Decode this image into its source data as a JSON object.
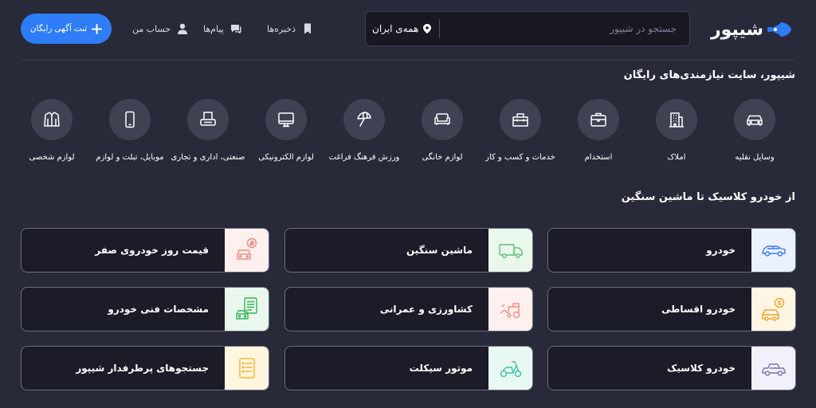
{
  "header": {
    "logo_text": "شیپور",
    "search": {
      "placeholder": "جستجو در شیپور",
      "value": ""
    },
    "city": "همه‌ی ایران",
    "nav": {
      "saved": "ذخیره‌ها",
      "messages": "پیام‌ها",
      "account": "حساب من"
    },
    "post_button": "ثبت آگهی رایگان"
  },
  "categories_title": "شیپور، سایت نیازمندی‌های رایگان",
  "categories": [
    {
      "label": "وسایل نقلیه",
      "icon": "car-icon"
    },
    {
      "label": "املاک",
      "icon": "building-icon"
    },
    {
      "label": "استخدام",
      "icon": "briefcase-icon"
    },
    {
      "label": "خدمات و کسب و کار",
      "icon": "toolbox-icon"
    },
    {
      "label": "لوازم خانگی",
      "icon": "sofa-icon"
    },
    {
      "label": "ورزش فرهنگ فراغت",
      "icon": "umbrella-icon"
    },
    {
      "label": "لوازم الکترونیکی",
      "icon": "monitor-icon"
    },
    {
      "label": "صنعتی، اداری و تجاری",
      "icon": "printer-icon"
    },
    {
      "label": "موبایل، تبلت و لوازم",
      "icon": "mobile-icon"
    },
    {
      "label": "لوازم شخصی",
      "icon": "jacket-icon"
    }
  ],
  "vehicles_title": "از خودرو کلاسیک تا ماشین سنگین",
  "vehicle_cards": [
    {
      "label": "خودرو",
      "icon": "car-icon",
      "bg": "#eaf2ff",
      "accent": "#3b7bf0"
    },
    {
      "label": "ماشین سنگین",
      "icon": "truck-icon",
      "bg": "#eaf7ec",
      "accent": "#5cc06f"
    },
    {
      "label": "قیمت روز خودروی صفر",
      "icon": "car-price-icon",
      "bg": "#fff0ef",
      "accent": "#f08a80"
    },
    {
      "label": "خودرو اقساطی",
      "icon": "car-installment-icon",
      "bg": "#fff5e3",
      "accent": "#f2a428"
    },
    {
      "label": "کشاورزی و عمرانی",
      "icon": "tractor-icon",
      "bg": "#fff0ef",
      "accent": "#f08a80"
    },
    {
      "label": "مشخصات فنی خودرو",
      "icon": "car-specs-icon",
      "bg": "#eaf7ec",
      "accent": "#35b35a"
    },
    {
      "label": "خودرو کلاسیک",
      "icon": "classic-car-icon",
      "bg": "#f2f0fb",
      "accent": "#7b75a8"
    },
    {
      "label": "موتور سیکلت",
      "icon": "scooter-icon",
      "bg": "#e8f8f3",
      "accent": "#3cc4a0"
    },
    {
      "label": "جستجوهای پرطرفدار شیپور",
      "icon": "list-icon",
      "bg": "#fff6e0",
      "accent": "#f2b52c"
    }
  ]
}
